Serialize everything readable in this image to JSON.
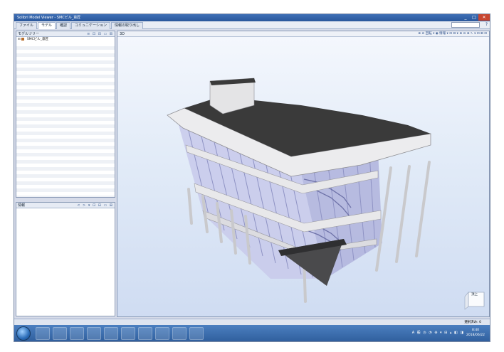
{
  "window": {
    "title": "Solibri Model Viewer - SMCビル_意匠",
    "controls": {
      "minimize": "_",
      "maximize": "□",
      "close": "✕"
    }
  },
  "menu": {
    "tabs": [
      {
        "label": "ファイル"
      },
      {
        "label": "モデル"
      },
      {
        "label": "確認"
      },
      {
        "label": "コミュニケーション"
      },
      {
        "label": "情報の取り出し"
      }
    ],
    "help": "?"
  },
  "model_tree": {
    "title": "モデルツリー",
    "tools": "≡ ⊡ ⊟ ▭ ⊞",
    "items": [
      {
        "toggle": "⊞",
        "label": "SMCビル_意匠"
      }
    ]
  },
  "info_panel": {
    "title": "情報",
    "tools": "< > ▾ ⊡ ⊟ ▭ ⊞"
  },
  "viewport": {
    "title": "3D",
    "tools": "⊕ ⊘ 回転 ▾ ◉ 情報 ▾ ⊡ ⊟ ▾ ⊕ ⊖ ⊗ ↖ ▾ ⊡ ⊞ ⊡"
  },
  "navcube": {
    "face_label": "頂上"
  },
  "status": {
    "selection": "選択済み: 0"
  },
  "taskbar": {
    "clock_time": "8:40",
    "clock_date": "2018/06/22",
    "tray": "A 般 ◷ ◔ ⊕ ▾ ⊞ ▴ ◧ ◨"
  },
  "colors": {
    "title_bar": "#2f5fa5",
    "roof": "#3a3a3a",
    "glass": "#b5b8dd",
    "slab": "#e8e8ea",
    "sky_top": "#f4f7fd",
    "sky_bottom": "#cfdcf2"
  }
}
